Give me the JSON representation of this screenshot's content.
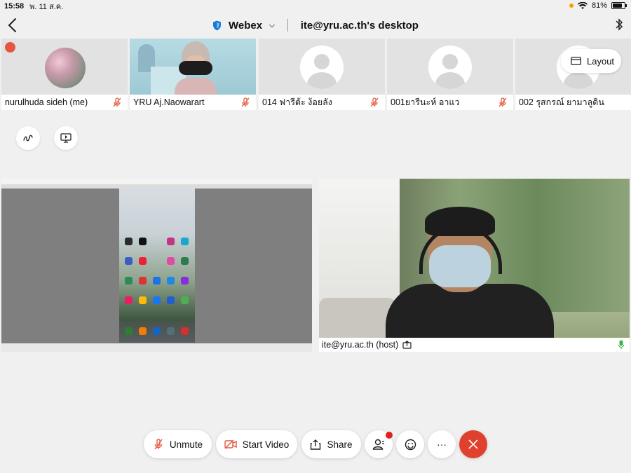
{
  "status_bar": {
    "time": "15:58",
    "date": "พ. 11 ส.ค.",
    "battery": "81%"
  },
  "nav": {
    "app_name": "Webex",
    "title": "ite@yru.ac.th's desktop"
  },
  "layout_button": {
    "label": "Layout"
  },
  "participants": [
    {
      "name": "nurulhuda sideh (me)"
    },
    {
      "name": "YRU Aj.Naowarart"
    },
    {
      "name": "014 ฟารีต้ะ ง้อยลัง"
    },
    {
      "name": "001ยารีนะห์ อาแว"
    },
    {
      "name": "002 รุสกรณ์ ยามาลูดิน"
    }
  ],
  "host_video": {
    "name": "ite@yru.ac.th (host)"
  },
  "controls": {
    "unmute_label": "Unmute",
    "start_video_label": "Start Video",
    "share_label": "Share",
    "more_label": "···"
  },
  "colors": {
    "end_call": "#e0412f",
    "mute_red": "#e3573e",
    "accent_blue": "#1b7ad8",
    "mic_green": "#3ab54a"
  },
  "icons": {
    "back": "chevron-left-icon",
    "bluetooth": "bluetooth-icon",
    "webex": "shield-icon",
    "annotate": "pen-squiggle-icon",
    "screen": "screen-share-icon",
    "mute": "mic-off-icon",
    "video": "video-off-icon",
    "share": "share-icon",
    "participants": "people-icon",
    "reactions": "emoji-icon",
    "end": "close-icon"
  }
}
